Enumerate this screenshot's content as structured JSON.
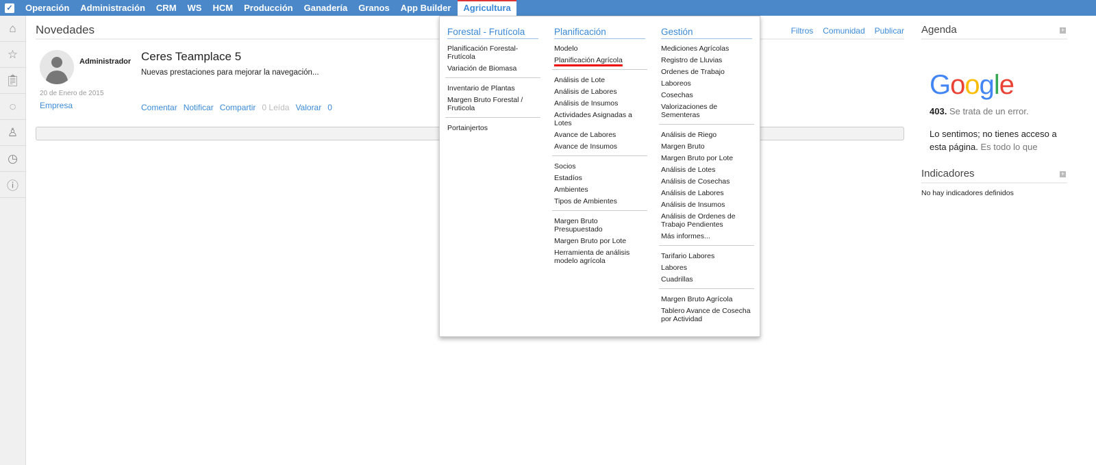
{
  "topnav": {
    "items": [
      "Operación",
      "Administración",
      "CRM",
      "WS",
      "HCM",
      "Producción",
      "Ganadería",
      "Granos",
      "App Builder"
    ],
    "active": "Agricultura"
  },
  "feed": {
    "title": "Novedades",
    "links": {
      "filtros": "Filtros",
      "comunidad": "Comunidad",
      "publicar": "Publicar"
    },
    "post": {
      "author": "Administrador",
      "date": "20 de Enero de 2015",
      "company": "Empresa",
      "title": "Ceres Teamplace 5",
      "subtitle": "Nuevas prestaciones para mejorar la navegación...",
      "actions": {
        "comentar": "Comentar",
        "notificar": "Notificar",
        "compartir": "Compartir",
        "leida": "0 Leída",
        "valorar": "Valorar",
        "rating": "0"
      }
    }
  },
  "agenda": {
    "title": "Agenda",
    "google": "Google",
    "code": "403.",
    "error": "Se trata de un error.",
    "msg": "Lo sentimos; no tienes acceso a esta página.",
    "msg2": "Es todo lo que"
  },
  "indicadores": {
    "title": "Indicadores",
    "empty": "No hay indicadores definidos"
  },
  "menu": {
    "col1": {
      "title": "Forestal - Frutícola",
      "groups": [
        [
          "Planificación Forestal- Frutícola",
          "Variación de Biomasa"
        ],
        [
          "Inventario de Plantas",
          "Margen Bruto Forestal / Fruticola"
        ],
        [
          "Portainjertos"
        ]
      ]
    },
    "col2": {
      "title": "Planificación",
      "groups": [
        [
          "Modelo",
          "Planificación Agrícola"
        ],
        [
          "Análisis de Lote",
          "Análisis de Labores",
          "Análisis de Insumos",
          "Actividades Asignadas a Lotes",
          "Avance de Labores",
          "Avance de Insumos"
        ],
        [
          "Socios",
          "Estadíos",
          "Ambientes",
          "Tipos de Ambientes"
        ],
        [
          "Margen Bruto Presupuestado",
          "Margen Bruto por Lote",
          "Herramienta de análisis modelo agrícola"
        ]
      ]
    },
    "col3": {
      "title": "Gestión",
      "groups": [
        [
          "Mediciones Agrícolas",
          "Registro de Lluvias",
          "Ordenes de Trabajo",
          "Laboreos",
          "Cosechas",
          "Valorizaciones de Sementeras"
        ],
        [
          "Análisis de Riego",
          "Margen Bruto",
          "Margen Bruto por Lote",
          "Análisis de Lotes",
          "Análisis de Cosechas",
          "Análisis de Labores",
          "Análisis de Insumos",
          "Análisis de Ordenes de Trabajo Pendientes",
          "Más informes..."
        ],
        [
          "Tarifario Labores",
          "Labores",
          "Cuadrillas"
        ],
        [
          "Margen Bruto Agrícola",
          "Tablero Avance de Cosecha por Actividad"
        ]
      ]
    }
  }
}
